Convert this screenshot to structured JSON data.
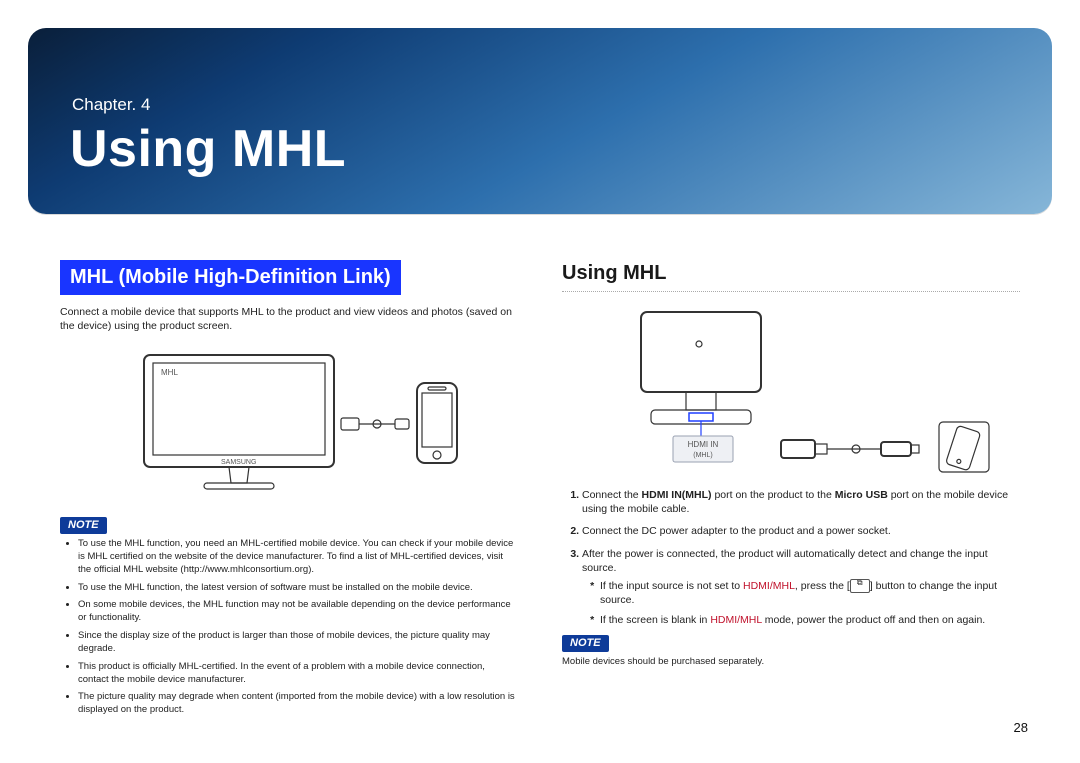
{
  "chapter": {
    "label": "Chapter. 4",
    "title": "Using MHL"
  },
  "left": {
    "heading": "MHL (Mobile High-Definition Link)",
    "intro": "Connect a mobile device that supports MHL to the product and view videos and photos (saved on the device) using the product screen.",
    "diagram_label": "MHL",
    "note_label": "NOTE",
    "notes": [
      "To use the MHL function, you need an MHL-certified mobile device. You can check if your mobile device is MHL certified on the website of the device manufacturer. To find a list of MHL-certified devices, visit the official MHL website (http://www.mhlconsortium.org).",
      "To use the MHL function, the latest version of software must be installed on the mobile device.",
      "On some mobile devices, the MHL function may not be available depending on the device performance or functionality.",
      "Since the display size of the product is larger than those of mobile devices, the picture quality may degrade.",
      "This product is officially MHL-certified. In the event of a problem with a mobile device connection, contact the mobile device manufacturer.",
      "The picture quality may degrade when content (imported from the mobile device) with a low resolution is displayed on the product."
    ]
  },
  "right": {
    "heading": "Using MHL",
    "port_label_top": "HDMI IN",
    "port_label_bottom": "(MHL)",
    "steps": [
      {
        "prefix": "Connect the ",
        "bold1": "HDMI IN(MHL)",
        "mid": " port on the product to the ",
        "bold2": "Micro USB",
        "suffix": " port on the mobile device using the mobile cable."
      },
      {
        "text": "Connect the DC power adapter to the product and a power socket."
      },
      {
        "text": "After the power is connected, the product will automatically detect and change the input source."
      }
    ],
    "substeps": [
      {
        "before": "If the input source is not set to ",
        "accent": "HDMI/MHL",
        "mid": ", press the [",
        "after": "] button to change the input source."
      },
      {
        "before": "If the screen is blank in ",
        "accent": "HDMI/MHL",
        "after": " mode, power the product off and then on again."
      }
    ],
    "note_label": "NOTE",
    "note_text": "Mobile devices should be purchased separately."
  },
  "page_number": "28"
}
